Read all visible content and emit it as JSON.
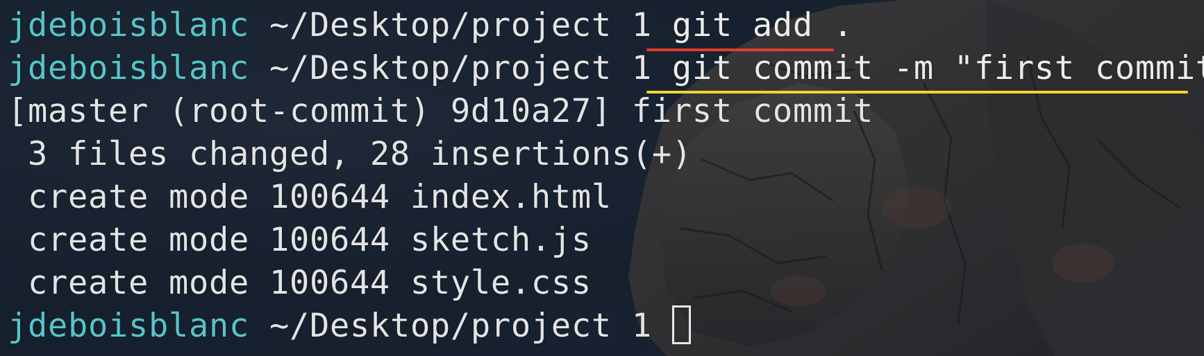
{
  "terminal": {
    "colors": {
      "prompt_user": "#56c5c8",
      "text": "#e4e4e4",
      "underline_add": "#e23c2b",
      "underline_commit": "#f2d534"
    },
    "lines": [
      {
        "user": "jdeboisblanc",
        "path": " ~/Desktop/project 1 ",
        "command": "git add ."
      },
      {
        "user": "jdeboisblanc",
        "path": " ~/Desktop/project 1 ",
        "command": "git commit -m \"first commit\""
      },
      {
        "output": "[master (root-commit) 9d10a27] first commit"
      },
      {
        "output": " 3 files changed, 28 insertions(+)"
      },
      {
        "output": " create mode 100644 index.html"
      },
      {
        "output": " create mode 100644 sketch.js"
      },
      {
        "output": " create mode 100644 style.css"
      },
      {
        "user": "jdeboisblanc",
        "path": " ~/Desktop/project 1 "
      }
    ]
  }
}
